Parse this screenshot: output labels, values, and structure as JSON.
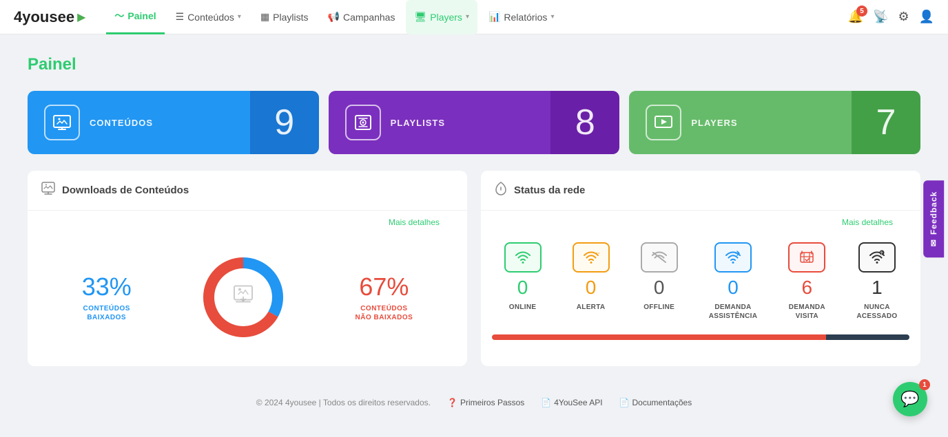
{
  "logo": {
    "text": "4yousee",
    "icon": "▶"
  },
  "nav": {
    "items": [
      {
        "id": "painel",
        "label": "Painel",
        "icon": "📊",
        "active": true,
        "hasDropdown": false
      },
      {
        "id": "conteudos",
        "label": "Conteúdos",
        "icon": "🖼",
        "active": false,
        "hasDropdown": true
      },
      {
        "id": "playlists",
        "label": "Playlists",
        "icon": "📋",
        "active": false,
        "hasDropdown": false
      },
      {
        "id": "campanhas",
        "label": "Campanhas",
        "icon": "📢",
        "active": false,
        "hasDropdown": false
      },
      {
        "id": "players",
        "label": "Players",
        "icon": "📺",
        "active": false,
        "hasDropdown": true,
        "highlighted": true
      },
      {
        "id": "relatorios",
        "label": "Relatórios",
        "icon": "📈",
        "active": false,
        "hasDropdown": true
      }
    ]
  },
  "header": {
    "notification_count": "5",
    "settings_icon": "⚙",
    "user_icon": "👤",
    "rss_icon": "📡"
  },
  "page_title": "Painel",
  "stat_cards": [
    {
      "id": "conteudos",
      "label": "CONTEÚDOS",
      "value": "9",
      "color": "blue",
      "icon": "🖼"
    },
    {
      "id": "playlists",
      "label": "PLAYLISTS",
      "value": "8",
      "color": "purple",
      "icon": "📋"
    },
    {
      "id": "players",
      "label": "PLAYERS",
      "value": "7",
      "color": "green",
      "icon": "▶"
    }
  ],
  "downloads_panel": {
    "title": "Downloads de Conteúdos",
    "mais_detalhes": "Mais detalhes",
    "downloaded_pct": "33%",
    "downloaded_label": "CONTEÚDOS\nBAIXADOS",
    "not_downloaded_pct": "67%",
    "not_downloaded_label": "CONTEÚDOS\nNÃO BAIXADOS",
    "donut": {
      "downloaded_degrees": 119,
      "not_downloaded_degrees": 241
    }
  },
  "status_panel": {
    "title": "Status da rede",
    "mais_detalhes": "Mais detalhes",
    "items": [
      {
        "id": "online",
        "count": "0",
        "label": "ONLINE",
        "type": "online"
      },
      {
        "id": "alerta",
        "count": "0",
        "label": "ALERTA",
        "type": "alerta"
      },
      {
        "id": "offline",
        "count": "0",
        "label": "OFFLINE",
        "type": "offline"
      },
      {
        "id": "demanda-assist",
        "count": "0",
        "label": "DEMANDA\nASSISTÊNCIA",
        "type": "demanda-assist"
      },
      {
        "id": "demanda-visita",
        "count": "6",
        "label": "DEMANDA\nVISITA",
        "type": "demanda-visita"
      },
      {
        "id": "nunca",
        "count": "1",
        "label": "NUNCA\nACESSADO",
        "type": "nunca"
      }
    ]
  },
  "feedback": {
    "label": "Feedback",
    "icon": "✉"
  },
  "footer": {
    "copyright": "© 2024 4yousee | Todos os direitos reservados.",
    "links": [
      {
        "id": "primeiros-passos",
        "label": "Primeiros Passos",
        "icon": "❓"
      },
      {
        "id": "api",
        "label": "4YouSee API",
        "icon": "📄"
      },
      {
        "id": "documentacoes",
        "label": "Documentações",
        "icon": "📄"
      }
    ]
  },
  "chat": {
    "badge": "1",
    "icon": "💬"
  }
}
